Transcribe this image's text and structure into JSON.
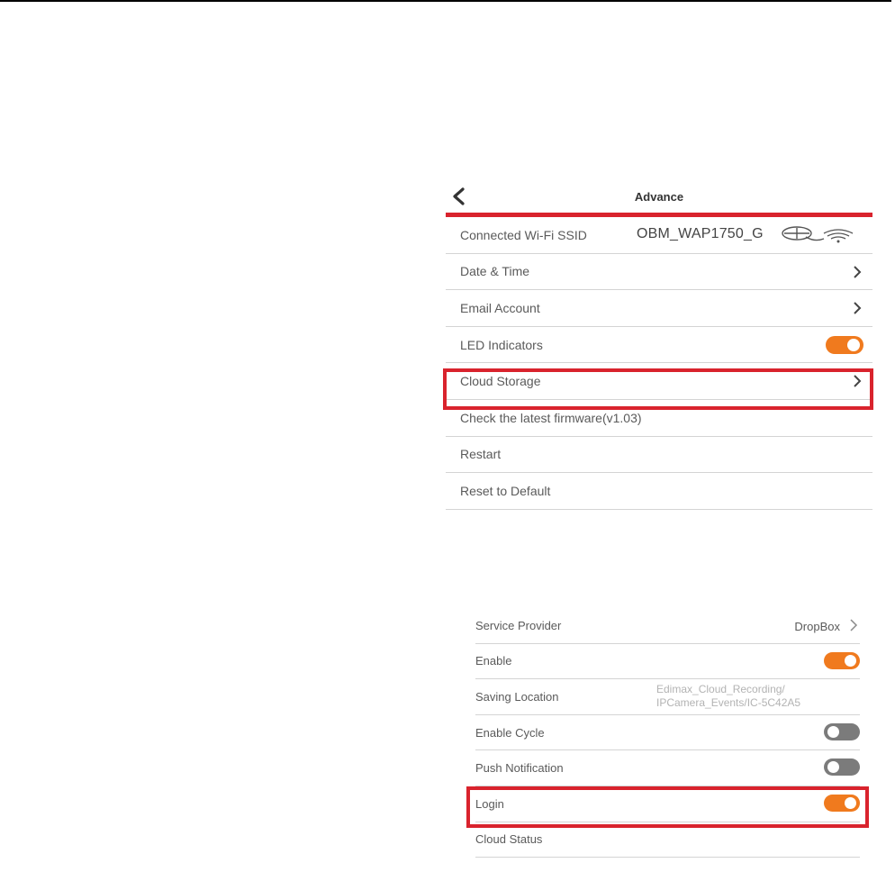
{
  "advance": {
    "title": "Advance",
    "rows": [
      {
        "label": "Connected Wi-Fi SSID",
        "value": "OBM_WAP1750_G"
      },
      {
        "label": "Date & Time"
      },
      {
        "label": "Email Account"
      },
      {
        "label": "LED Indicators",
        "toggle": "on"
      },
      {
        "label": "Cloud Storage"
      },
      {
        "label": "Check the latest firmware(v1.03)"
      },
      {
        "label": "Restart"
      },
      {
        "label": "Reset to Default"
      }
    ]
  },
  "cloud": {
    "rows": [
      {
        "label": "Service Provider",
        "value": "DropBox"
      },
      {
        "label": "Enable",
        "toggle": "on"
      },
      {
        "label": "Saving Location",
        "value_line1": "Edimax_Cloud_Recording/",
        "value_line2": "IPCamera_Events/IC-5C42A5"
      },
      {
        "label": "Enable Cycle",
        "toggle": "off"
      },
      {
        "label": "Push Notification",
        "toggle": "off"
      },
      {
        "label": "Login",
        "toggle": "on"
      },
      {
        "label": "Cloud Status"
      }
    ]
  },
  "colors": {
    "accent_red": "#d9232d",
    "toggle_on": "#f07a1e",
    "toggle_off": "#7b7b7b"
  }
}
